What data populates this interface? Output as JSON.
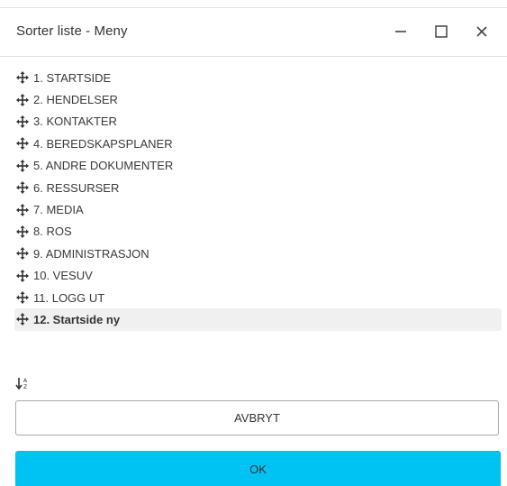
{
  "dialog": {
    "title": "Sorter liste - Meny"
  },
  "window_controls": {
    "minimize_icon": "minimize-icon",
    "maximize_icon": "maximize-icon",
    "close_icon": "close-icon"
  },
  "menu_list": {
    "items": [
      {
        "label": "1. STARTSIDE",
        "selected": false
      },
      {
        "label": "2. HENDELSER",
        "selected": false
      },
      {
        "label": "3. KONTAKTER",
        "selected": false
      },
      {
        "label": "4. BEREDSKAPSPLANER",
        "selected": false
      },
      {
        "label": "5. ANDRE DOKUMENTER",
        "selected": false
      },
      {
        "label": "6. RESSURSER",
        "selected": false
      },
      {
        "label": "7. MEDIA",
        "selected": false
      },
      {
        "label": "8. ROS",
        "selected": false
      },
      {
        "label": "9. ADMINISTRASJON",
        "selected": false
      },
      {
        "label": "10. VESUV",
        "selected": false
      },
      {
        "label": "11. LOGG UT",
        "selected": false
      },
      {
        "label": "12. Startside ny",
        "selected": true
      }
    ],
    "drag_icon": "move-arrows-icon"
  },
  "sort": {
    "icon": "sort-alpha-ascending-icon"
  },
  "actions": {
    "cancel_label": "AVBRYT",
    "ok_label": "OK"
  },
  "colors": {
    "ok_button": "#00c2f3",
    "selected_row": "#f0f0f0",
    "border": "#a9a9a9"
  }
}
